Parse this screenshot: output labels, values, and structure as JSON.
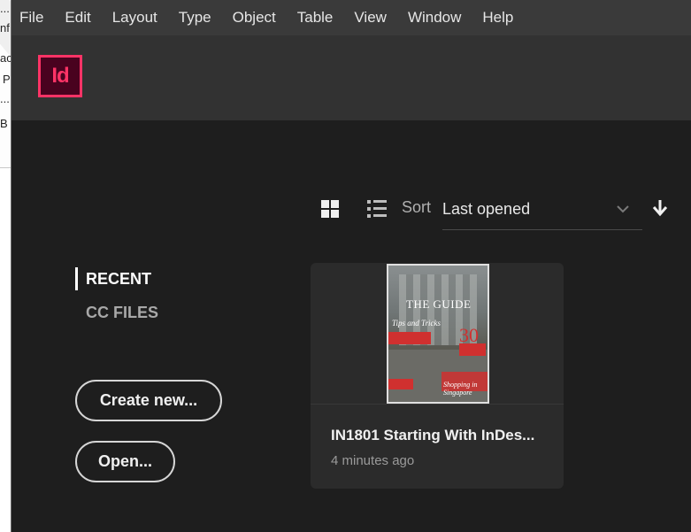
{
  "background_window": {
    "fragments": [
      "...",
      "nf",
      "ac",
      "P",
      "...",
      "B"
    ]
  },
  "menubar": {
    "items": [
      "File",
      "Edit",
      "Layout",
      "Type",
      "Object",
      "Table",
      "View",
      "Window",
      "Help"
    ]
  },
  "app": {
    "logo_text": "Id",
    "logo_color": "#ff3366"
  },
  "toolbar": {
    "grid_view_icon": "grid-icon",
    "list_view_icon": "list-icon",
    "sort_label": "Sort",
    "sort_value": "Last opened",
    "sort_direction_icon": "arrow-down-icon"
  },
  "nav": {
    "recent": "RECENT",
    "cc_files": "CC FILES"
  },
  "buttons": {
    "create_new": "Create new...",
    "open": "Open..."
  },
  "recent_files": [
    {
      "title": "IN1801 Starting With InDes...",
      "time": "4 minutes ago",
      "thumbnail": {
        "headline": "THE GUIDE",
        "number": "30",
        "script_top": "Tips and Tricks",
        "script_bottom": "Shopping in Singapore"
      }
    }
  ]
}
